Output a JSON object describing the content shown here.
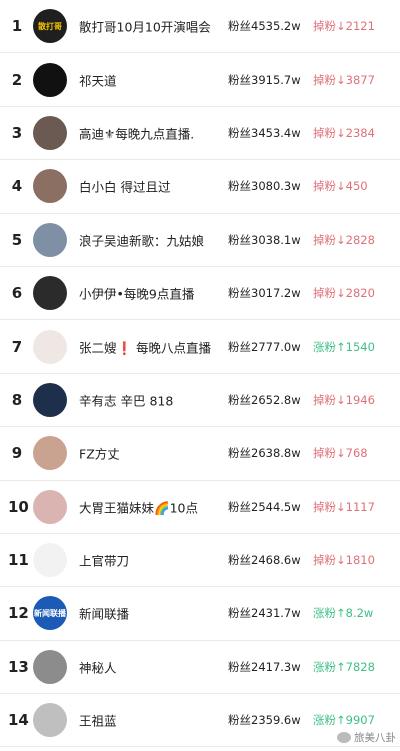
{
  "rows": [
    {
      "rank": "1",
      "name": "散打哥10月10开演唱会",
      "fans": "粉丝4535.2w",
      "change": "掉粉↓2121",
      "trend": "down",
      "avatar_text": "散打哥",
      "avatar_color": "#1f1f1f",
      "avatar_fg": "#f5c400"
    },
    {
      "rank": "2",
      "name": "祁天道",
      "fans": "粉丝3915.7w",
      "change": "掉粉↓3877",
      "trend": "down",
      "avatar_text": "",
      "avatar_color": "#111111",
      "avatar_fg": "#ffffff"
    },
    {
      "rank": "3",
      "name": "高迪⚜每晚九点直播.",
      "fans": "粉丝3453.4w",
      "change": "掉粉↓2384",
      "trend": "down",
      "avatar_text": "",
      "avatar_color": "#6b5a52",
      "avatar_fg": "#ffffff"
    },
    {
      "rank": "4",
      "name": "白小白 得过且过",
      "fans": "粉丝3080.3w",
      "change": "掉粉↓450",
      "trend": "down",
      "avatar_text": "",
      "avatar_color": "#8a6f62",
      "avatar_fg": "#ffffff"
    },
    {
      "rank": "5",
      "name": "浪子吴迪新歌：九姑娘",
      "fans": "粉丝3038.1w",
      "change": "掉粉↓2828",
      "trend": "down",
      "avatar_text": "",
      "avatar_color": "#7f8fa6",
      "avatar_fg": "#ffffff"
    },
    {
      "rank": "6",
      "name": "小伊伊•每晚9点直播",
      "fans": "粉丝3017.2w",
      "change": "掉粉↓2820",
      "trend": "down",
      "avatar_text": "",
      "avatar_color": "#2b2b2b",
      "avatar_fg": "#ffffff"
    },
    {
      "rank": "7",
      "name": "张二嫂❗ 每晚八点直播",
      "fans": "粉丝2777.0w",
      "change": "涨粉↑1540",
      "trend": "up",
      "avatar_text": "",
      "avatar_color": "#efe7e4",
      "avatar_fg": "#222222"
    },
    {
      "rank": "8",
      "name": "辛有志 辛巴 818",
      "fans": "粉丝2652.8w",
      "change": "掉粉↓1946",
      "trend": "down",
      "avatar_text": "",
      "avatar_color": "#1d2f4a",
      "avatar_fg": "#ffffff"
    },
    {
      "rank": "9",
      "name": "FZ方丈",
      "fans": "粉丝2638.8w",
      "change": "掉粉↓768",
      "trend": "down",
      "avatar_text": "",
      "avatar_color": "#c9a38f",
      "avatar_fg": "#ffffff"
    },
    {
      "rank": "10",
      "name": "大胃王猫妹妹🌈10点",
      "fans": "粉丝2544.5w",
      "change": "掉粉↓1117",
      "trend": "down",
      "avatar_text": "",
      "avatar_color": "#d9b4b0",
      "avatar_fg": "#ffffff"
    },
    {
      "rank": "11",
      "name": "上官带刀",
      "fans": "粉丝2468.6w",
      "change": "掉粉↓1810",
      "trend": "down",
      "avatar_text": "",
      "avatar_color": "#f2f2f2",
      "avatar_fg": "#111111"
    },
    {
      "rank": "12",
      "name": "新闻联播",
      "fans": "粉丝2431.7w",
      "change": "涨粉↑8.2w",
      "trend": "up",
      "avatar_text": "新闻联播",
      "avatar_color": "#1c5bb5",
      "avatar_fg": "#ffffff"
    },
    {
      "rank": "13",
      "name": "神秘人",
      "fans": "粉丝2417.3w",
      "change": "涨粉↑7828",
      "trend": "up",
      "avatar_text": "",
      "avatar_color": "#8c8c8c",
      "avatar_fg": "#ffffff"
    },
    {
      "rank": "14",
      "name": "王祖蓝",
      "fans": "粉丝2359.6w",
      "change": "涨粉↑9907",
      "trend": "up",
      "avatar_text": "",
      "avatar_color": "#bfbfbf",
      "avatar_fg": "#ffffff"
    }
  ],
  "watermark": {
    "text": "旅美八卦",
    "icon": "chat-bubble-icon"
  },
  "colors": {
    "down": "#e06f79",
    "up": "#3fbf88"
  }
}
